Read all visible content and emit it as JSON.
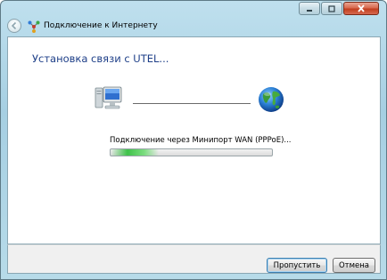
{
  "window": {
    "title": "Подключение к Интернету"
  },
  "main": {
    "heading": "Установка связи с UTEL...",
    "status_text": "Подключение через Минипорт WAN (PPPoE)...",
    "progress_fraction": 0.3,
    "progress_indeterminate": true
  },
  "footer": {
    "skip_label": "Пропустить",
    "cancel_label": "Отмена"
  },
  "icons": {
    "back": "back-arrow-icon",
    "wizard": "network-wizard-icon",
    "computer": "computer-icon",
    "globe": "globe-icon",
    "minimize": "minimize-icon",
    "maximize": "maximize-icon",
    "close": "close-icon"
  },
  "colors": {
    "heading": "#1e3f88",
    "progress": "#3fc24a",
    "close_button": "#c23f1f"
  }
}
